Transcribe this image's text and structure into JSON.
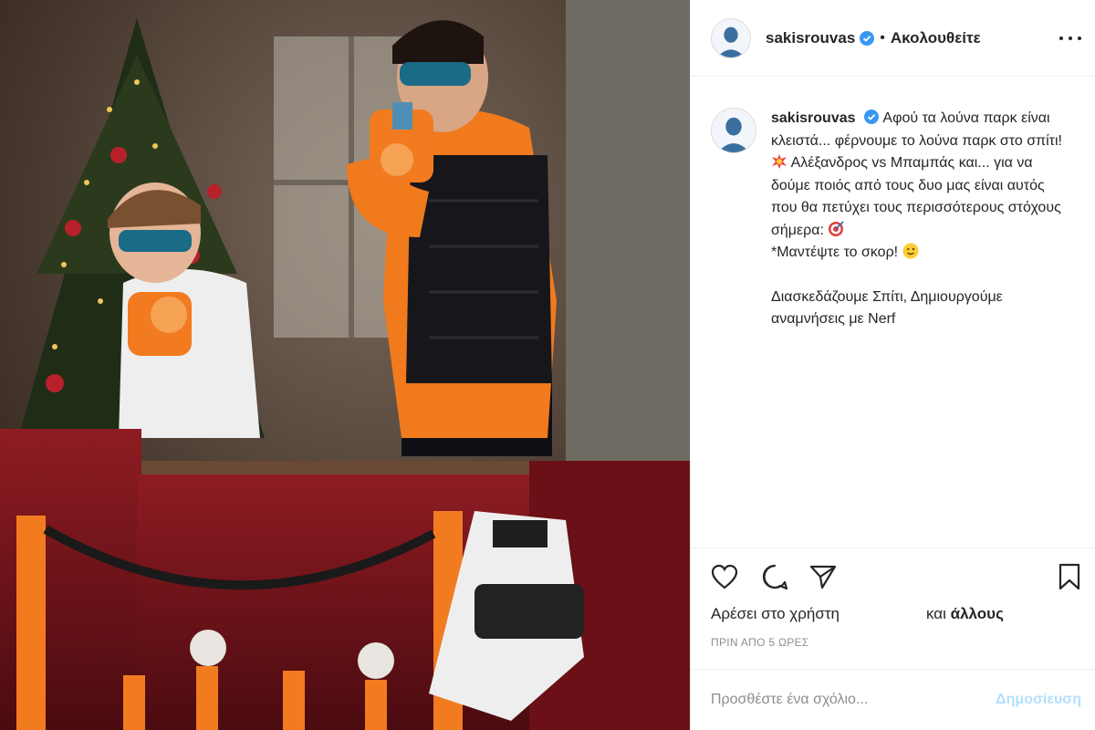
{
  "post": {
    "username": "sakisrouvas",
    "follow_separator": "•",
    "follow_status": "Ακολουθείτε",
    "caption_lines": [
      "Αφού τα λούνα παρκ είναι κλειστά... φέρνουμε το λούνα παρκ στο σπίτι!",
      "Αλέξανδρος vs Μπαμπάς και... για να δούμε ποιός από τους δυο μας είναι αυτός που θα πετύχει τους περισσότερους στόχους σήμερα:",
      "*Μαντέψτε το σκορ!",
      "Διασκεδάζουμε Σπίτι, Δημιουργούμε αναμνήσεις με Nerf"
    ],
    "likes_prefix": "Αρέσει στο χρήστη",
    "likes_and": "και",
    "likes_others": "άλλους",
    "time_ago": "ΠΡΙΝ ΑΠΟ 5 ΩΡΕΣ"
  },
  "comment_box": {
    "placeholder": "Προσθέστε ένα σχόλιο...",
    "post_label": "Δημοσίευση"
  },
  "icons": {
    "verified": "verified-badge-icon",
    "like": "heart-icon",
    "comment": "comment-icon",
    "share": "share-icon",
    "save": "bookmark-icon",
    "more": "more-options-icon",
    "emoji_collision": "collision-emoji-icon",
    "emoji_target": "target-emoji-icon",
    "emoji_wink": "winking-face-emoji-icon"
  },
  "colors": {
    "verified_blue": "#3897f0",
    "text": "#262626",
    "muted": "#8e8e8e",
    "post_button_disabled": "#b2dffc"
  }
}
